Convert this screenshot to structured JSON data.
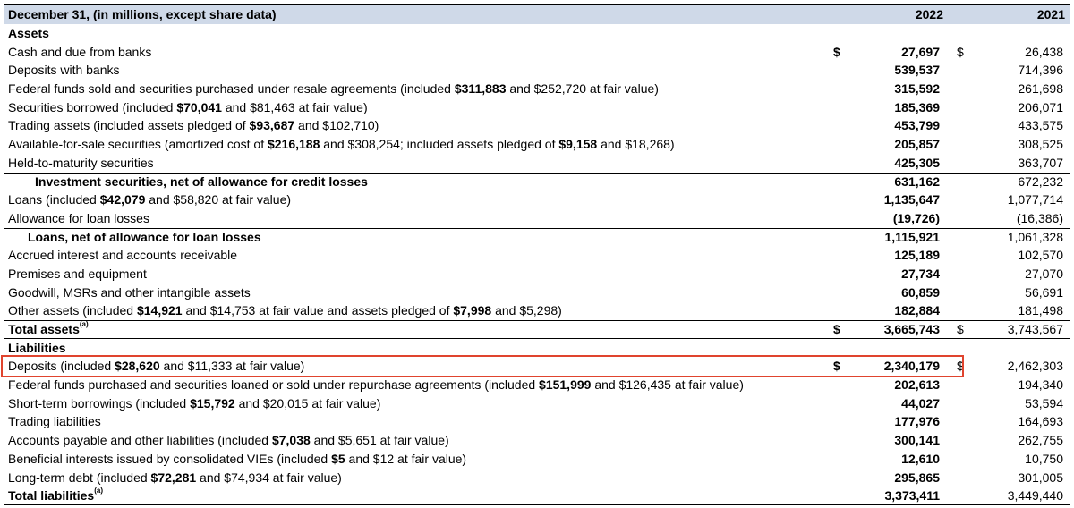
{
  "header": {
    "label": "December 31, (in millions, except share data)",
    "col_2022": "2022",
    "col_2021": "2021"
  },
  "rows": [
    {
      "label": "Assets",
      "section": true
    },
    {
      "parts": [
        {
          "t": "Cash and due from banks"
        }
      ],
      "cur1": "$",
      "v2022": "27,697",
      "cur2": "$",
      "v2021": "26,438"
    },
    {
      "parts": [
        {
          "t": "Deposits with banks"
        }
      ],
      "v2022": "539,537",
      "v2021": "714,396"
    },
    {
      "parts": [
        {
          "t": "Federal funds sold and securities purchased under resale agreements (included "
        },
        {
          "t": "$311,883",
          "b": true
        },
        {
          "t": " and $252,720 at fair value)"
        }
      ],
      "v2022": "315,592",
      "v2021": "261,698"
    },
    {
      "parts": [
        {
          "t": "Securities borrowed (included "
        },
        {
          "t": "$70,041",
          "b": true
        },
        {
          "t": " and $81,463 at fair value)"
        }
      ],
      "v2022": "185,369",
      "v2021": "206,071"
    },
    {
      "parts": [
        {
          "t": "Trading assets (included assets pledged of "
        },
        {
          "t": "$93,687",
          "b": true
        },
        {
          "t": " and $102,710)"
        }
      ],
      "v2022": "453,799",
      "v2021": "433,575"
    },
    {
      "parts": [
        {
          "t": "Available-for-sale securities (amortized cost of "
        },
        {
          "t": "$216,188",
          "b": true
        },
        {
          "t": " and $308,254; included assets pledged of "
        },
        {
          "t": "$9,158",
          "b": true
        },
        {
          "t": " and $18,268)"
        }
      ],
      "v2022": "205,857",
      "v2021": "308,525"
    },
    {
      "parts": [
        {
          "t": "Held-to-maturity securities"
        }
      ],
      "v2022": "425,305",
      "v2021": "363,707"
    },
    {
      "parts": [
        {
          "t": "Investment securities, net of allowance for credit losses",
          "b": true
        }
      ],
      "v2022": "631,162",
      "v2021": "672,232",
      "indent": "wide",
      "topline": true
    },
    {
      "parts": [
        {
          "t": "Loans (included "
        },
        {
          "t": "$42,079",
          "b": true
        },
        {
          "t": " and $58,820 at fair value)"
        }
      ],
      "v2022": "1,135,647",
      "v2021": "1,077,714"
    },
    {
      "parts": [
        {
          "t": "Allowance for loan losses"
        }
      ],
      "v2022": "(19,726)",
      "v2021": "(16,386)"
    },
    {
      "parts": [
        {
          "t": "Loans, net of allowance for loan losses",
          "b": true
        }
      ],
      "v2022": "1,115,921",
      "v2021": "1,061,328",
      "indent": "small",
      "topline": true
    },
    {
      "parts": [
        {
          "t": "Accrued interest and accounts receivable"
        }
      ],
      "v2022": "125,189",
      "v2021": "102,570"
    },
    {
      "parts": [
        {
          "t": "Premises and equipment"
        }
      ],
      "v2022": "27,734",
      "v2021": "27,070"
    },
    {
      "parts": [
        {
          "t": "Goodwill, MSRs and other intangible assets"
        }
      ],
      "v2022": "60,859",
      "v2021": "56,691"
    },
    {
      "parts": [
        {
          "t": "Other assets (included "
        },
        {
          "t": "$14,921",
          "b": true
        },
        {
          "t": " and $14,753 at fair value and assets pledged of "
        },
        {
          "t": "$7,998",
          "b": true
        },
        {
          "t": " and $5,298)"
        }
      ],
      "v2022": "182,884",
      "v2021": "181,498"
    },
    {
      "parts": [
        {
          "t": "Total assets",
          "b": true
        }
      ],
      "sup": "(a)",
      "cur1": "$",
      "v2022": "3,665,743",
      "cur2": "$",
      "v2021": "3,743,567",
      "topline": true,
      "bottomline": true
    },
    {
      "label": "Liabilities",
      "section": true
    },
    {
      "parts": [
        {
          "t": "Deposits (included "
        },
        {
          "t": "$28,620",
          "b": true
        },
        {
          "t": " and $11,333 at fair value)"
        }
      ],
      "cur1": "$",
      "v2022": "2,340,179",
      "cur2": "$",
      "v2021": "2,462,303",
      "highlight": true
    },
    {
      "parts": [
        {
          "t": "Federal funds purchased and securities loaned or sold under repurchase agreements (included "
        },
        {
          "t": "$151,999",
          "b": true
        },
        {
          "t": " and $126,435 at fair value)"
        }
      ],
      "v2022": "202,613",
      "v2021": "194,340"
    },
    {
      "parts": [
        {
          "t": "Short-term borrowings (included "
        },
        {
          "t": "$15,792",
          "b": true
        },
        {
          "t": " and $20,015 at fair value)"
        }
      ],
      "v2022": "44,027",
      "v2021": "53,594"
    },
    {
      "parts": [
        {
          "t": "Trading liabilities"
        }
      ],
      "v2022": "177,976",
      "v2021": "164,693"
    },
    {
      "parts": [
        {
          "t": "Accounts payable and other liabilities (included "
        },
        {
          "t": "$7,038",
          "b": true
        },
        {
          "t": " and $5,651 at fair value)"
        }
      ],
      "v2022": "300,141",
      "v2021": "262,755"
    },
    {
      "parts": [
        {
          "t": "Beneficial interests issued by consolidated VIEs (included "
        },
        {
          "t": "$5",
          "b": true
        },
        {
          "t": " and $12 at fair value)"
        }
      ],
      "v2022": "12,610",
      "v2021": "10,750"
    },
    {
      "parts": [
        {
          "t": "Long-term debt (included "
        },
        {
          "t": "$72,281",
          "b": true
        },
        {
          "t": " and $74,934 at fair value)"
        }
      ],
      "v2022": "295,865",
      "v2021": "301,005"
    },
    {
      "parts": [
        {
          "t": "Total liabilities",
          "b": true
        }
      ],
      "sup": "(a)",
      "v2022": "3,373,411",
      "v2021": "3,449,440",
      "topline": true,
      "bottomline": true
    }
  ],
  "colors": {
    "header_bg": "#cfd9e8",
    "highlight_border": "#e0442e"
  }
}
